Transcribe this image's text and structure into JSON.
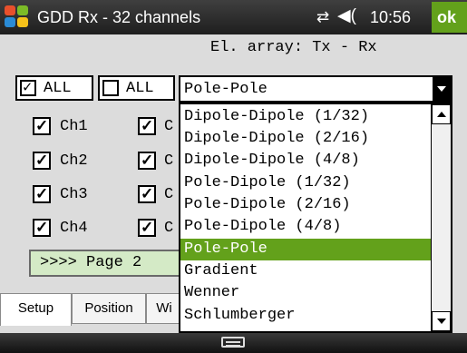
{
  "titlebar": {
    "app_title": "GDD Rx - 32 channels",
    "clock": "10:56",
    "ok_label": "ok",
    "connection_glyph": "⇄",
    "sound_glyph": "◀("
  },
  "setup": {
    "array_label": "El. array: Tx - Rx",
    "all_check_label": "ALL",
    "all_uncheck_label": "ALL",
    "channels_col1": [
      "Ch1",
      "Ch2",
      "Ch3",
      "Ch4"
    ],
    "channels_col2_partial": [
      "C",
      "C",
      "C",
      "C"
    ],
    "page_button_label": ">>>> Page 2"
  },
  "combo": {
    "selected_value": "Pole-Pole",
    "options": [
      "Dipole-Dipole (1/32)",
      "Dipole-Dipole (2/16)",
      "Dipole-Dipole (4/8)",
      "Pole-Dipole (1/32)",
      "Pole-Dipole (2/16)",
      "Pole-Dipole (4/8)",
      "Pole-Pole",
      "Gradient",
      "Wenner",
      "Schlumberger"
    ],
    "highlighted_index": 6,
    "highlight_color": "#63a11b"
  },
  "tabs": [
    "Setup",
    "Position",
    "Wi"
  ],
  "active_tab": "Setup",
  "colors": {
    "accent": "#63a11b",
    "titlebar": "#2a2a2a",
    "page_button_bg": "#d4eac6"
  }
}
